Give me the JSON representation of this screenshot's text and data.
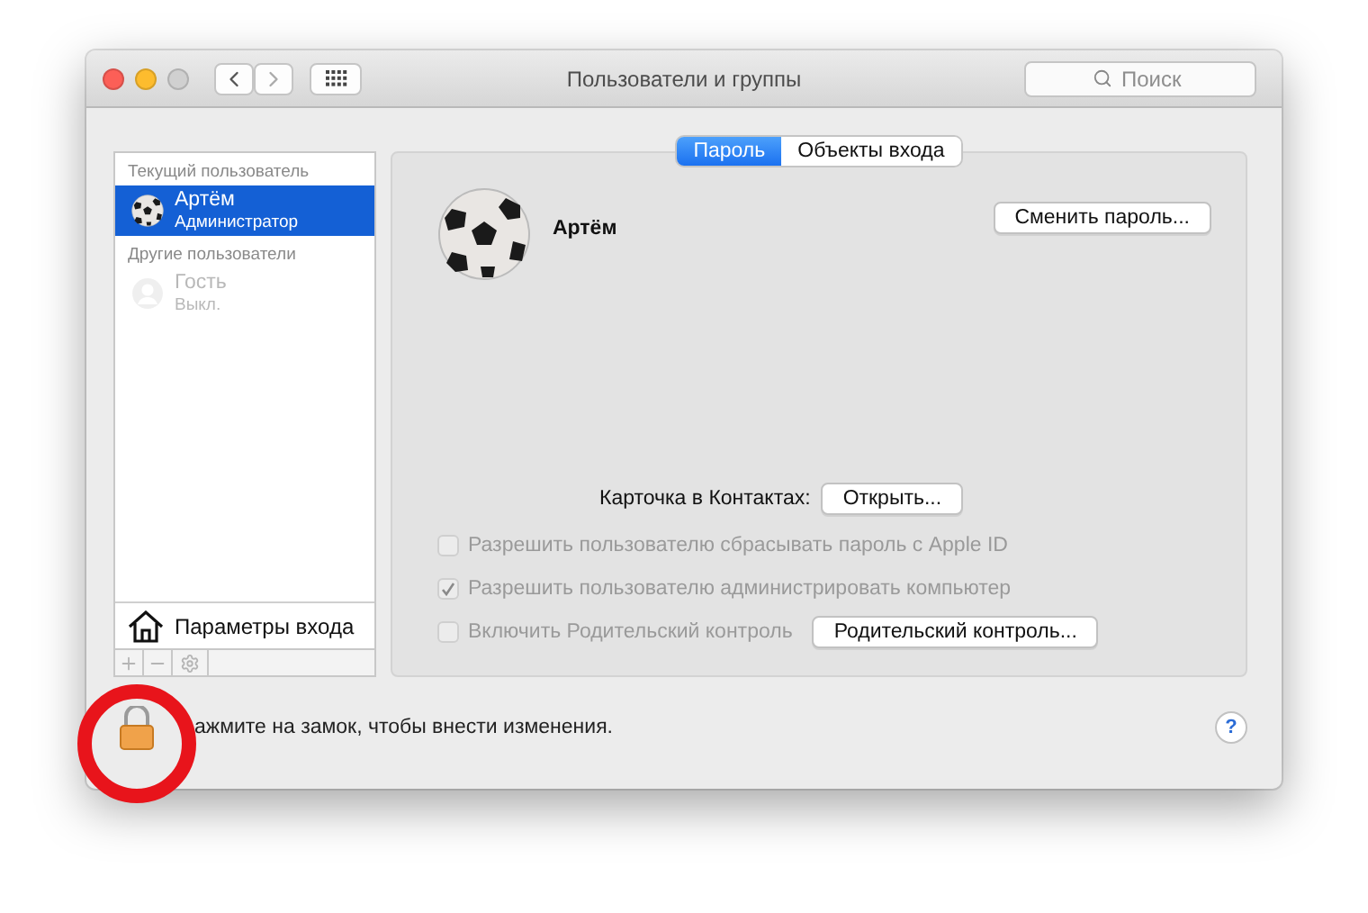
{
  "window": {
    "title": "Пользователи и группы"
  },
  "search": {
    "placeholder": "Поиск"
  },
  "sidebar": {
    "sections": [
      {
        "header": "Текущий пользователь",
        "users": [
          {
            "name": "Артём",
            "role": "Администратор",
            "selected": true,
            "kind": "ball",
            "disabled": false
          }
        ]
      },
      {
        "header": "Другие пользователи",
        "users": [
          {
            "name": "Гость",
            "role": "Выкл.",
            "selected": false,
            "kind": "generic",
            "disabled": true
          }
        ]
      }
    ],
    "login_options": "Параметры входа"
  },
  "tabs": [
    {
      "label": "Пароль",
      "selected": true
    },
    {
      "label": "Объекты входа",
      "selected": false
    }
  ],
  "user": {
    "name": "Артём",
    "change_password_button": "Сменить пароль..."
  },
  "contacts": {
    "label": "Карточка в Контактах:",
    "button": "Открыть..."
  },
  "options": [
    {
      "label": "Разрешить пользователю сбрасывать пароль с Apple ID",
      "checked": false,
      "disabled": true
    },
    {
      "label": "Разрешить пользователю администрировать компьютер",
      "checked": true,
      "disabled": true
    },
    {
      "label": "Включить Родительский контроль",
      "checked": false,
      "disabled": true,
      "button": "Родительский контроль..."
    }
  ],
  "status": {
    "text": "ажмите на замок, чтобы внести изменения.",
    "help": "?"
  }
}
